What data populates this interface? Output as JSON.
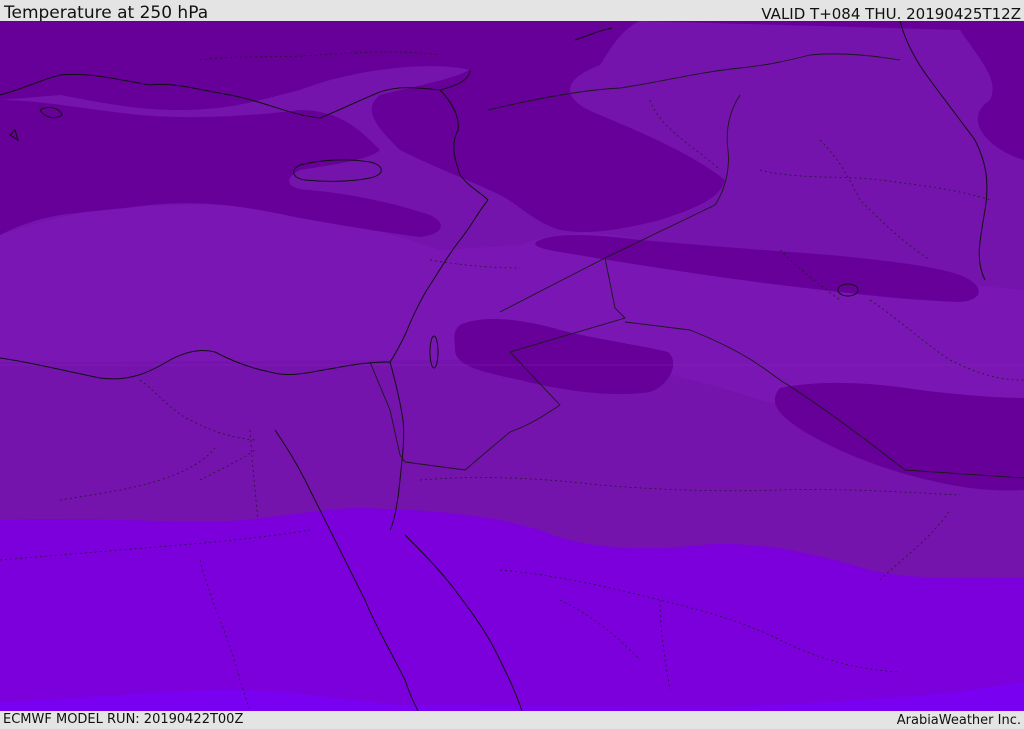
{
  "header": {
    "title": "Temperature at 250 hPa",
    "valid": "VALID T+084 THU. 20190425T12Z"
  },
  "footer": {
    "model_run": "ECMWF MODEL RUN: 20190422T00Z",
    "credit": "ArabiaWeather Inc."
  },
  "map": {
    "region": "Eastern Mediterranean and Middle East",
    "field": "Temperature at 250 hPa",
    "colors": {
      "band_darkest": "#660099",
      "band_dark": "#7513ad",
      "band_medium": "#7a16b3",
      "band_bright": "#7c00dc",
      "band_brightest": "#7a00f2",
      "coastline": "#111111",
      "border": "#222222"
    }
  }
}
